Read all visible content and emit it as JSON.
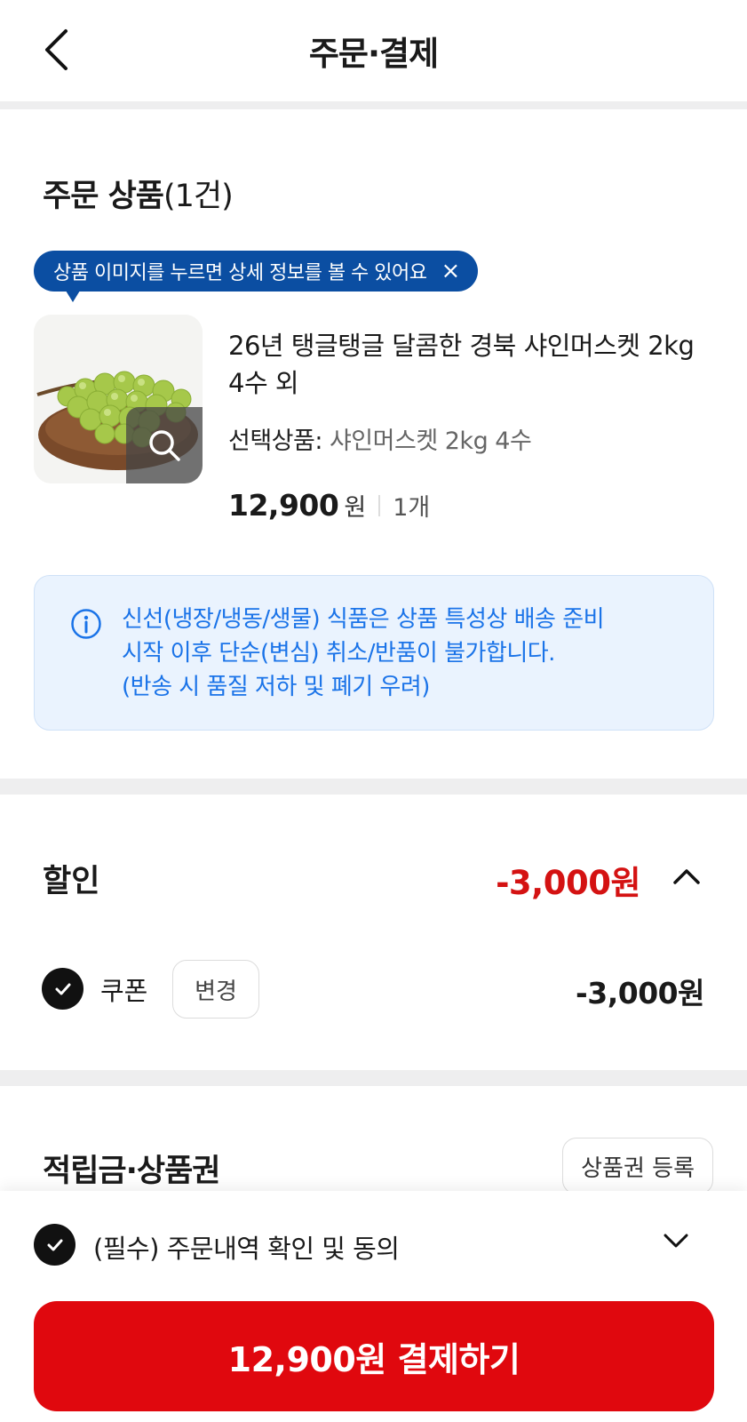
{
  "header": {
    "title": "주문·결제"
  },
  "order": {
    "section_title": "주문 상품",
    "count": "(1건)",
    "tooltip": "상품 이미지를 누르면 상세 정보를 볼 수 있어요",
    "product": {
      "name": "26년 탱글탱글 달콤한 경북 샤인머스켓 2kg 4수 외",
      "option_label": "선택상품:",
      "option_value": "샤인머스켓 2kg 4수",
      "price": "12,900",
      "currency": "원",
      "quantity": "1개"
    },
    "notice": [
      "신선(냉장/냉동/생물) 식품은 상품 특성상 배송 준비",
      "시작 이후 단순(변심) 취소/반품이 불가합니다.",
      "(반송 시 품질 저하 및 폐기 우려)"
    ]
  },
  "discount": {
    "title": "할인",
    "total": "-3,000원",
    "coupon_label": "쿠폰",
    "change_label": "변경",
    "coupon_amount": "-3,000원"
  },
  "points": {
    "title": "적립금·상품권",
    "register_label": "상품권 등록"
  },
  "footer": {
    "agree_label": "(필수) 주문내역 확인 및 동의",
    "pay_label": "12,900원 결제하기"
  },
  "colors": {
    "accent_red": "#e0080e",
    "discount_red": "#d41212",
    "tooltip_blue": "#0b4ea2",
    "notice_blue": "#1a73e8",
    "notice_bg": "#eaf3fe"
  },
  "icons": [
    "chevron-left-icon",
    "close-icon",
    "search-icon",
    "info-icon",
    "chevron-up-icon",
    "check-icon",
    "chevron-down-icon"
  ]
}
